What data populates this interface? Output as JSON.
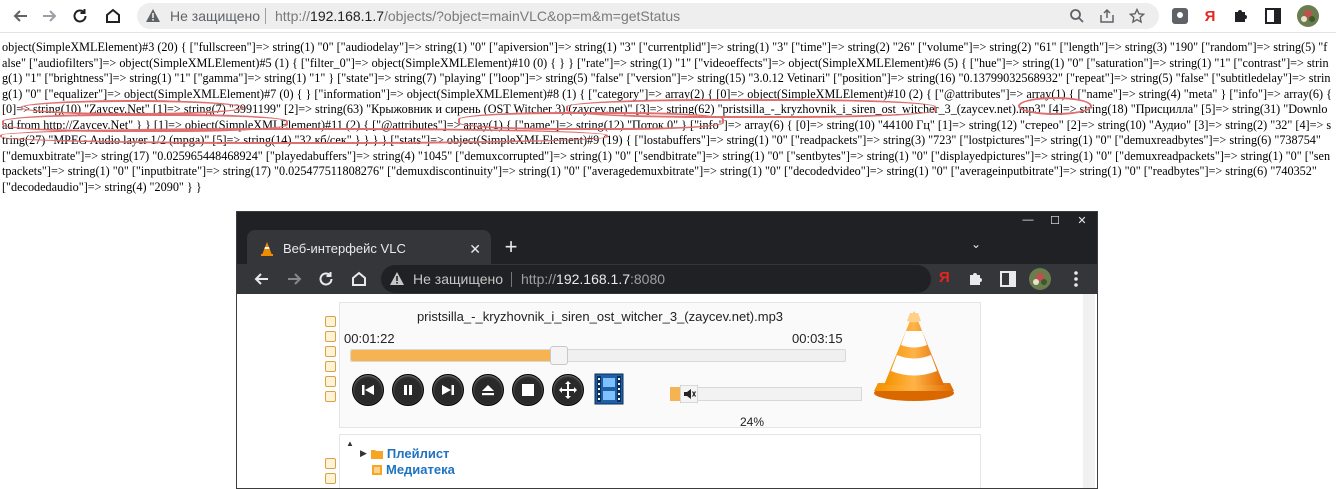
{
  "browser": {
    "security_label": "Не защищено",
    "url_scheme": "http://",
    "url_host": "192.168.1.7",
    "url_path": "/objects/?object=mainVLC&op=m&m=getStatus",
    "yandex_label": "Я"
  },
  "dump_text": "object(SimpleXMLElement)#3 (20) { [\"fullscreen\"]=> string(1) \"0\" [\"audiodelay\"]=> string(1) \"0\" [\"apiversion\"]=> string(1) \"3\" [\"currentplid\"]=> string(1) \"3\" [\"time\"]=> string(2) \"26\" [\"volume\"]=> string(2) \"61\" [\"length\"]=> string(3) \"190\" [\"random\"]=> string(5) \"false\" [\"audiofilters\"]=> object(SimpleXMLElement)#5 (1) { [\"filter_0\"]=> object(SimpleXMLElement)#10 (0) { } } [\"rate\"]=> string(1) \"1\" [\"videoeffects\"]=> object(SimpleXMLElement)#6 (5) { [\"hue\"]=> string(1) \"0\" [\"saturation\"]=> string(1) \"1\" [\"contrast\"]=> string(1) \"1\" [\"brightness\"]=> string(1) \"1\" [\"gamma\"]=> string(1) \"1\" } [\"state\"]=> string(7) \"playing\" [\"loop\"]=> string(5) \"false\" [\"version\"]=> string(15) \"3.0.12 Vetinari\" [\"position\"]=> string(16) \"0.13799032568932\" [\"repeat\"]=> string(5) \"false\" [\"subtitledelay\"]=> string(1) \"0\" [\"equalizer\"]=> object(SimpleXMLElement)#7 (0) { } [\"information\"]=> object(SimpleXMLElement)#8 (1) { [\"category\"]=> array(2) { [0]=> object(SimpleXMLElement)#10 (2) { [\"@attributes\"]=> array(1) { [\"name\"]=> string(4) \"meta\" } [\"info\"]=> array(6) { [0]=> string(10) \"Zaycev.Net\" [1]=> string(7) \"3991199\" [2]=> string(63) \"Крыжовник и сирень (OST Witcher 3) (zaycev.net)\" [3]=> string(62) \"pristsilla_-_kryzhovnik_i_siren_ost_witcher_3_(zaycev.net).mp3\" [4]=> string(18) \"Присцилла\" [5]=> string(31) \"Download from http://Zaycev.Net\" } } [1]=> object(SimpleXMLElement)#11 (2) { [\"@attributes\"]=> array(1) { [\"name\"]=> string(12) \"Поток 0\" } [\"info\"]=> array(6) { [0]=> string(10) \"44100 Гц\" [1]=> string(12) \"стерео\" [2]=> string(10) \"Аудио\" [3]=> string(2) \"32\" [4]=> string(27) \"MPEG Audio layer 1/2 (mpga)\" [5]=> string(14) \"32 кб/сек\" } } } } [\"stats\"]=> object(SimpleXMLElement)#9 (19) { [\"lostabuffers\"]=> string(1) \"0\" [\"readpackets\"]=> string(3) \"723\" [\"lostpictures\"]=> string(1) \"0\" [\"demuxreadbytes\"]=> string(6) \"738754\" [\"demuxbitrate\"]=> string(17) \"0.025965448468924\" [\"playedabuffers\"]=> string(4) \"1045\" [\"demuxcorrupted\"]=> string(1) \"0\" [\"sendbitrate\"]=> string(1) \"0\" [\"sentbytes\"]=> string(1) \"0\" [\"displayedpictures\"]=> string(1) \"0\" [\"demuxreadpackets\"]=> string(1) \"0\" [\"sentpackets\"]=> string(1) \"0\" [\"inputbitrate\"]=> string(17) \"0.025477511808276\" [\"demuxdiscontinuity\"]=> string(1) \"0\" [\"averagedemuxbitrate\"]=> string(1) \"0\" [\"decodedvideo\"]=> string(1) \"0\" [\"averageinputbitrate\"]=> string(1) \"0\" [\"readbytes\"]=> string(6) \"740352\" [\"decodedaudio\"]=> string(4) \"2090\" } }",
  "vlc_window": {
    "tab_title": "Веб-интерфейс VLC",
    "security_label": "Не защищено",
    "url_scheme": "http://",
    "url_host": "192.168.1.7",
    "url_port": ":8080",
    "yandex_label": "Я",
    "player": {
      "track_title": "pristsilla_-_kryzhovnik_i_siren_ost_witcher_3_(zaycev.net).mp3",
      "time_elapsed": "00:01:22",
      "time_total": "00:03:15",
      "seek_fraction": 0.42,
      "volume_percent": "24%",
      "volume_fraction": 0.24
    },
    "library": {
      "playlist_label": "Плейлист",
      "media_library_label": "Медиатека"
    },
    "colors": {
      "accent": "#f6b352",
      "link": "#1e73c2"
    }
  }
}
